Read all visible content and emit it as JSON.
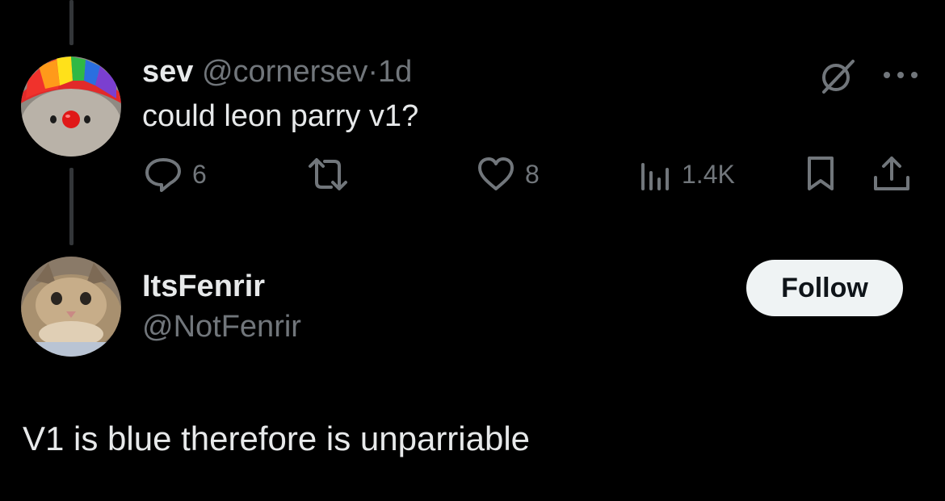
{
  "thread": {
    "parent": {
      "display_name": "sev",
      "handle": "@cornersev",
      "separator": "·",
      "time": "1d",
      "text": "could leon parry v1?",
      "avatar_icon": "clown-avatar",
      "menu_icon": "more-icon",
      "grok_icon": "grok-icon",
      "actions": {
        "replies": "6",
        "reposts": "",
        "likes": "8",
        "views": "1.4K"
      }
    },
    "reply": {
      "display_name": "ItsFenrir",
      "handle": "@NotFenrir",
      "avatar_icon": "cat-avatar",
      "follow_label": "Follow",
      "text": "V1 is blue therefore is unparriable"
    }
  },
  "colors": {
    "background": "#000000",
    "text_primary": "#e7e9ea",
    "text_muted": "#71767b",
    "thread_line": "#333639",
    "follow_bg": "#eff3f4"
  }
}
